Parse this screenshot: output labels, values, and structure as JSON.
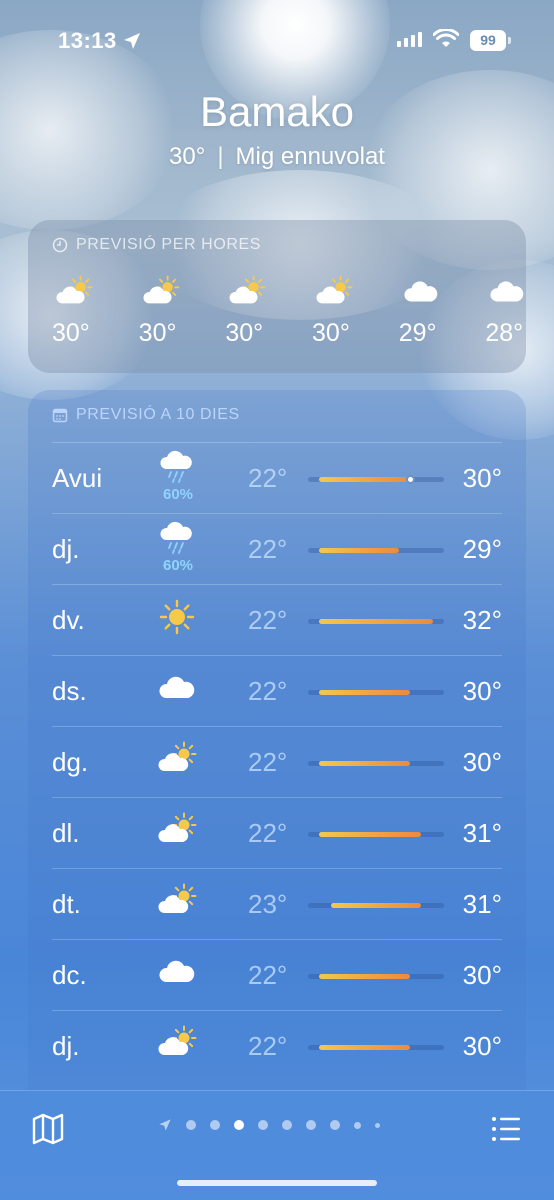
{
  "status_bar": {
    "time": "13:13",
    "battery": "99"
  },
  "header": {
    "city": "Bamako",
    "current_temp": "30°",
    "separator": "|",
    "condition": "Mig ennuvolat"
  },
  "hourly": {
    "title": "PREVISIÓ PER HORES",
    "items": [
      {
        "icon": "partly-cloudy-icon",
        "temp": "30°"
      },
      {
        "icon": "partly-cloudy-icon",
        "temp": "30°"
      },
      {
        "icon": "partly-cloudy-icon",
        "temp": "30°"
      },
      {
        "icon": "partly-cloudy-icon",
        "temp": "30°"
      },
      {
        "icon": "cloud-icon",
        "temp": "29°"
      },
      {
        "icon": "cloud-icon",
        "temp": "28°"
      }
    ]
  },
  "daily": {
    "title": "PREVISIÓ A 10 DIES",
    "range_scale": {
      "min": 21,
      "max": 33
    },
    "current_temp_value": 30,
    "days": [
      {
        "name": "Avui",
        "icon": "rain-cloud-icon",
        "precip": "60%",
        "low": "22°",
        "high": "30°",
        "low_v": 22,
        "high_v": 30,
        "now": true
      },
      {
        "name": "dj.",
        "icon": "rain-cloud-icon",
        "precip": "60%",
        "low": "22°",
        "high": "29°",
        "low_v": 22,
        "high_v": 29
      },
      {
        "name": "dv.",
        "icon": "sun-icon",
        "precip": "",
        "low": "22°",
        "high": "32°",
        "low_v": 22,
        "high_v": 32
      },
      {
        "name": "ds.",
        "icon": "cloud-icon",
        "precip": "",
        "low": "22°",
        "high": "30°",
        "low_v": 22,
        "high_v": 30
      },
      {
        "name": "dg.",
        "icon": "partly-cloudy-icon",
        "precip": "",
        "low": "22°",
        "high": "30°",
        "low_v": 22,
        "high_v": 30
      },
      {
        "name": "dl.",
        "icon": "partly-cloudy-icon",
        "precip": "",
        "low": "22°",
        "high": "31°",
        "low_v": 22,
        "high_v": 31
      },
      {
        "name": "dt.",
        "icon": "partly-cloudy-icon",
        "precip": "",
        "low": "23°",
        "high": "31°",
        "low_v": 23,
        "high_v": 31
      },
      {
        "name": "dc.",
        "icon": "cloud-icon",
        "precip": "",
        "low": "22°",
        "high": "30°",
        "low_v": 22,
        "high_v": 30
      },
      {
        "name": "dj.",
        "icon": "partly-cloudy-icon",
        "precip": "",
        "low": "22°",
        "high": "30°",
        "low_v": 22,
        "high_v": 30
      }
    ]
  },
  "page_indicator": {
    "count": 10,
    "active_index": 3
  },
  "colors": {
    "accent_precip": "#8fd3ff",
    "bar_start": "#f2c94c",
    "bar_end": "#ec8a3f",
    "sun": "#f7c948"
  }
}
